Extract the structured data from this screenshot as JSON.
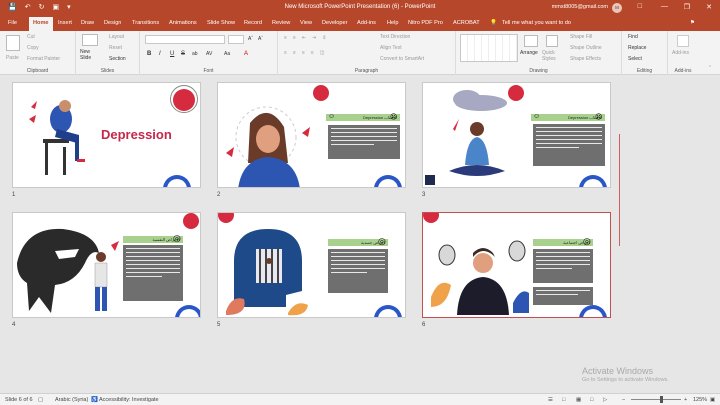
{
  "window": {
    "title": "New Microsoft PowerPoint Presentation (6)  -  PowerPoint",
    "account": "mmst8005@gmail.com",
    "avatar": "M"
  },
  "tabs": [
    "File",
    "Home",
    "Insert",
    "Draw",
    "Design",
    "Transitions",
    "Animations",
    "Slide Show",
    "Record",
    "Review",
    "View",
    "Developer",
    "Add-ins",
    "Help",
    "Nitro PDF Pro",
    "ACROBAT"
  ],
  "tell_me": "Tell me what you want to do",
  "ribbon": {
    "clipboard": {
      "label": "Clipboard",
      "paste": "Paste",
      "cut": "Cut",
      "copy": "Copy",
      "format_painter": "Format Painter"
    },
    "slides": {
      "label": "Slides",
      "new_slide": "New Slide",
      "layout": "Layout",
      "reset": "Reset",
      "section": "Section"
    },
    "font": {
      "label": "Font",
      "bold": "B",
      "italic": "I",
      "underline": "U",
      "strike": "S",
      "shadow": "ab",
      "spacing": "AV",
      "case": "Aa",
      "color": "A"
    },
    "paragraph": {
      "label": "Paragraph",
      "text_direction": "Text Direction",
      "align_text": "Align Text",
      "smartart": "Convert to SmartArt"
    },
    "drawing": {
      "label": "Drawing",
      "arrange": "Arrange",
      "quick_styles": "Quick Styles",
      "shape_fill": "Shape Fill",
      "shape_outline": "Shape Outline",
      "shape_effects": "Shape Effects"
    },
    "editing": {
      "label": "Editing",
      "find": "Find",
      "replace": "Replace",
      "select": "Select"
    },
    "addins": {
      "label": "Add-ins",
      "addins": "Add-ins"
    }
  },
  "slides": [
    {
      "number": "1",
      "title": "Depression"
    },
    {
      "number": "2",
      "heading": "Depression الاكتئاب"
    },
    {
      "number": "3",
      "heading": "Depression الاكتئاب"
    },
    {
      "number": "4",
      "heading": "الاعراض النفسية"
    },
    {
      "number": "5",
      "heading": "اعراض جسدية"
    },
    {
      "number": "6",
      "heading": "اعراض اجتماعية"
    }
  ],
  "status": {
    "slide": "Slide 6 of 6",
    "language": "Arabic (Syria)",
    "accessibility": "Accessibility: Investigate",
    "zoom": "125%"
  },
  "watermark": {
    "line1": "Activate Windows",
    "line2": "Go to Settings to activate Windows."
  },
  "colors": {
    "brand": "#b7472a",
    "accent_red": "#d62b3f",
    "accent_blue": "#2a57c8",
    "green_bar": "#a9d18e"
  }
}
